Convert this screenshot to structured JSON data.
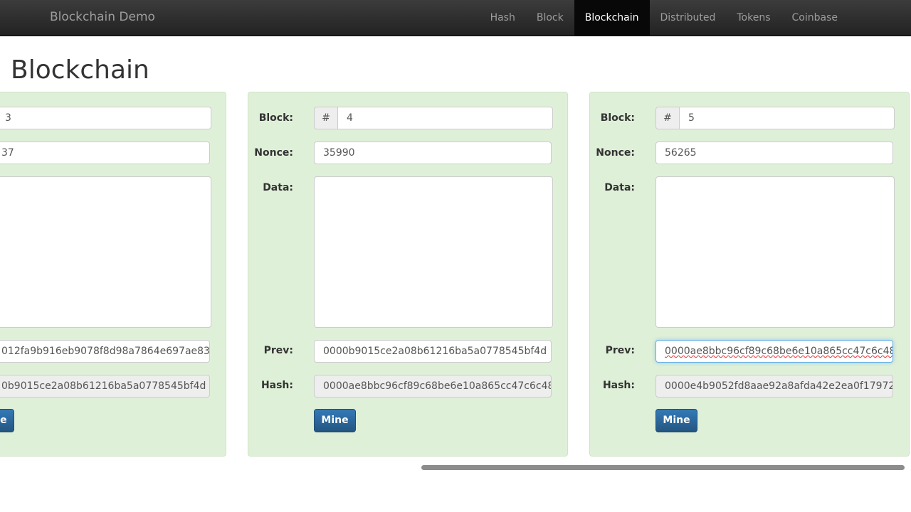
{
  "navbar": {
    "brand": "Blockchain Demo",
    "items": [
      {
        "label": "Hash",
        "active": false
      },
      {
        "label": "Block",
        "active": false
      },
      {
        "label": "Blockchain",
        "active": true
      },
      {
        "label": "Distributed",
        "active": false
      },
      {
        "label": "Tokens",
        "active": false
      },
      {
        "label": "Coinbase",
        "active": false
      }
    ]
  },
  "page_title": "Blockchain",
  "labels": {
    "block": "Block:",
    "nonce": "Nonce:",
    "data": "Data:",
    "prev": "Prev:",
    "hash": "Hash:",
    "mine": "Mine",
    "hash_prefix": "#"
  },
  "blocks": [
    {
      "block": "3",
      "nonce": "37",
      "data": "",
      "prev": "012fa9b916eb9078f8d98a7864e697ae83",
      "hash": "0b9015ce2a08b61216ba5a0778545bf4d"
    },
    {
      "block": "4",
      "nonce": "35990",
      "data": "",
      "prev": "0000b9015ce2a08b61216ba5a0778545bf4d",
      "hash": "0000ae8bbc96cf89c68be6e10a865cc47c6c48"
    },
    {
      "block": "5",
      "nonce": "56265",
      "data": "",
      "prev": "0000ae8bbc96cf89c68be6e10a865cc47c6c48",
      "hash": "0000e4b9052fd8aae92a8afda42e2ea0f17972"
    }
  ],
  "colors": {
    "card_bg": "#dff0d8",
    "button": "#337ab7",
    "navbar": "#222222"
  }
}
